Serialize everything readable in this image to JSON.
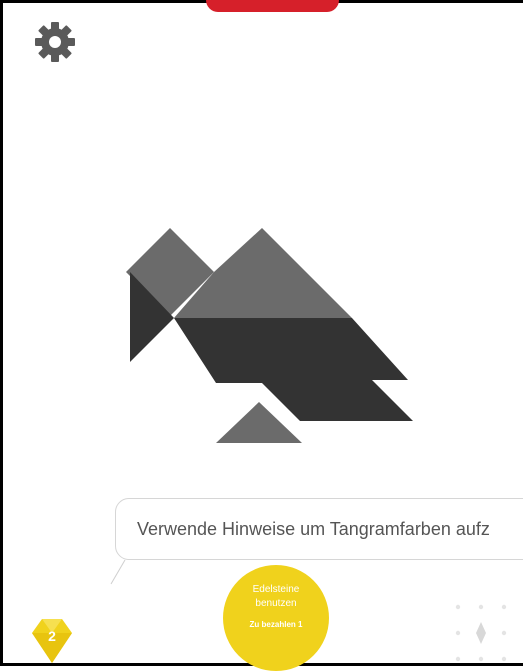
{
  "top_tab": {
    "color": "#d6202a"
  },
  "settings": {
    "icon": "gear-icon",
    "color": "#5a5a5a"
  },
  "puzzle": {
    "colors": {
      "light": "#6b6b6b",
      "dark": "#333333"
    }
  },
  "hint": {
    "text": "Verwende Hinweise um Tangramfarben aufz"
  },
  "gems": {
    "count": "2",
    "icon": "diamond-icon",
    "color": "#f0d21c"
  },
  "gem_button": {
    "line1": "Edelsteine",
    "line2": "benutzen",
    "line3": "Zu bezahlen 1",
    "color": "#f0d21c"
  },
  "hint_dots": {
    "icon": "arrow-up-icon"
  }
}
